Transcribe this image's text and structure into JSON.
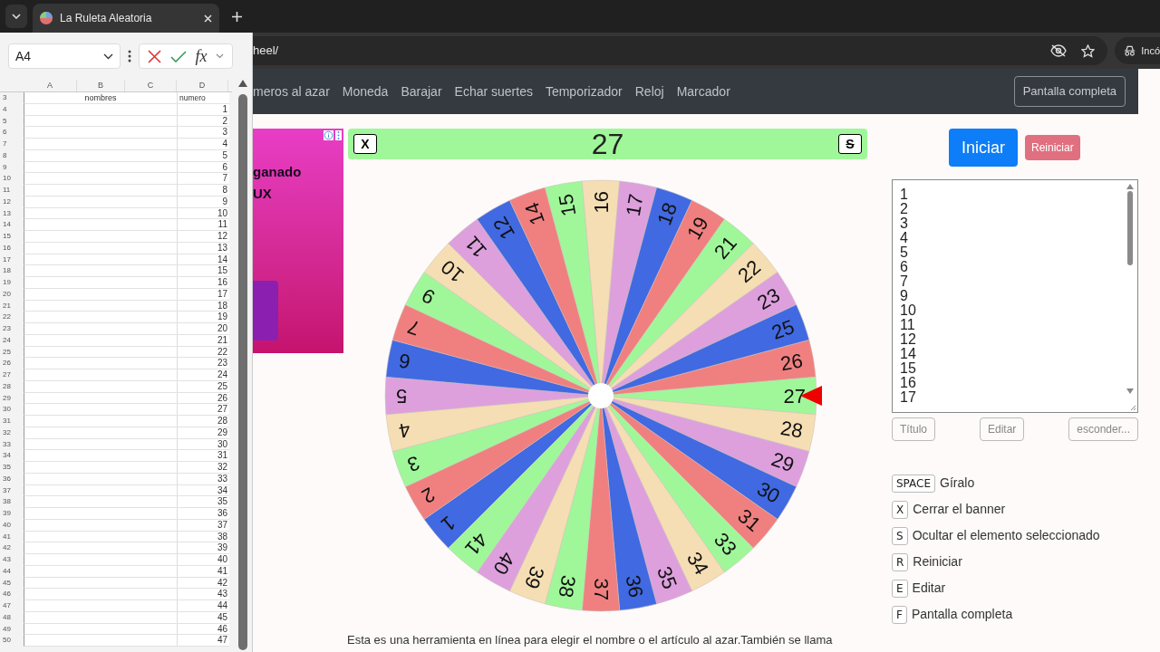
{
  "browser": {
    "tab_title": "La Ruleta Aleatoria",
    "url": "heel/",
    "profile": "Incó"
  },
  "spreadsheet": {
    "name_box": "A4",
    "function_button": "fx",
    "columns": [
      "A",
      "B",
      "C",
      "D"
    ],
    "rows": [
      {
        "row": "3",
        "kind": "header",
        "b": "nombres",
        "d": "numero"
      },
      {
        "row": "4",
        "kind": "value",
        "d": "1"
      },
      {
        "row": "5",
        "kind": "value",
        "d": "2"
      },
      {
        "row": "6",
        "kind": "value",
        "d": "3"
      },
      {
        "row": "7",
        "kind": "value",
        "d": "4"
      },
      {
        "row": "8",
        "kind": "value",
        "d": "5"
      },
      {
        "row": "9",
        "kind": "value",
        "d": "6"
      },
      {
        "row": "10",
        "kind": "value",
        "d": "7"
      },
      {
        "row": "11",
        "kind": "value",
        "d": "8"
      },
      {
        "row": "12",
        "kind": "value",
        "d": "9"
      },
      {
        "row": "13",
        "kind": "value",
        "d": "10"
      },
      {
        "row": "14",
        "kind": "value",
        "d": "11"
      },
      {
        "row": "15",
        "kind": "value",
        "d": "12"
      },
      {
        "row": "16",
        "kind": "value",
        "d": "13"
      },
      {
        "row": "17",
        "kind": "value",
        "d": "14"
      },
      {
        "row": "18",
        "kind": "value",
        "d": "15"
      },
      {
        "row": "19",
        "kind": "value",
        "d": "16"
      },
      {
        "row": "20",
        "kind": "value",
        "d": "17"
      },
      {
        "row": "21",
        "kind": "value",
        "d": "18"
      },
      {
        "row": "22",
        "kind": "value",
        "d": "19"
      },
      {
        "row": "23",
        "kind": "value",
        "d": "20"
      },
      {
        "row": "24",
        "kind": "value",
        "d": "21"
      },
      {
        "row": "25",
        "kind": "value",
        "d": "22"
      },
      {
        "row": "26",
        "kind": "value",
        "d": "23"
      },
      {
        "row": "27",
        "kind": "value",
        "d": "24"
      },
      {
        "row": "28",
        "kind": "value",
        "d": "25"
      },
      {
        "row": "29",
        "kind": "value",
        "d": "26"
      },
      {
        "row": "30",
        "kind": "value",
        "d": "27"
      },
      {
        "row": "31",
        "kind": "value",
        "d": "28"
      },
      {
        "row": "32",
        "kind": "value",
        "d": "29"
      },
      {
        "row": "33",
        "kind": "value",
        "d": "30"
      },
      {
        "row": "34",
        "kind": "value",
        "d": "31"
      },
      {
        "row": "35",
        "kind": "value",
        "d": "32"
      },
      {
        "row": "36",
        "kind": "value",
        "d": "33"
      },
      {
        "row": "37",
        "kind": "value",
        "d": "34"
      },
      {
        "row": "38",
        "kind": "value",
        "d": "35"
      },
      {
        "row": "39",
        "kind": "value",
        "d": "36"
      },
      {
        "row": "40",
        "kind": "value",
        "d": "37"
      },
      {
        "row": "41",
        "kind": "value",
        "d": "38"
      },
      {
        "row": "42",
        "kind": "value",
        "d": "39"
      },
      {
        "row": "43",
        "kind": "value",
        "d": "40"
      },
      {
        "row": "44",
        "kind": "value",
        "d": "41"
      },
      {
        "row": "45",
        "kind": "value",
        "d": "42"
      },
      {
        "row": "46",
        "kind": "value",
        "d": "43"
      },
      {
        "row": "47",
        "kind": "value",
        "d": "44"
      },
      {
        "row": "48",
        "kind": "value",
        "d": "45"
      },
      {
        "row": "49",
        "kind": "value",
        "d": "46"
      },
      {
        "row": "50",
        "kind": "value",
        "d": "47"
      }
    ]
  },
  "nav": {
    "links": [
      "meros al azar",
      "Moneda",
      "Barajar",
      "Echar suertes",
      "Temporizador",
      "Reloj",
      "Marcador"
    ],
    "fullscreen_button": "Pantalla completa"
  },
  "ad": {
    "texts": [
      "ganado",
      "UX"
    ]
  },
  "result": {
    "close_key": "X",
    "value": "27",
    "hide_key": "S"
  },
  "wheel": {
    "segments": [
      {
        "label": "1"
      },
      {
        "label": "2"
      },
      {
        "label": "3"
      },
      {
        "label": "4"
      },
      {
        "label": "5"
      },
      {
        "label": "6"
      },
      {
        "label": "7"
      },
      {
        "label": "9"
      },
      {
        "label": "10"
      },
      {
        "label": "11"
      },
      {
        "label": "12"
      },
      {
        "label": "14"
      },
      {
        "label": "15"
      },
      {
        "label": "16"
      },
      {
        "label": "17"
      },
      {
        "label": "18"
      },
      {
        "label": "19"
      },
      {
        "label": "21"
      },
      {
        "label": "22"
      },
      {
        "label": "23"
      },
      {
        "label": "25"
      },
      {
        "label": "26"
      },
      {
        "label": "27"
      },
      {
        "label": "28"
      },
      {
        "label": "29"
      },
      {
        "label": "30"
      },
      {
        "label": "31"
      },
      {
        "label": "33"
      },
      {
        "label": "34"
      },
      {
        "label": "35"
      },
      {
        "label": "36"
      },
      {
        "label": "37"
      },
      {
        "label": "38"
      },
      {
        "label": "39"
      },
      {
        "label": "40"
      },
      {
        "label": "41"
      }
    ]
  },
  "controls": {
    "start": "Iniciar",
    "reset": "Reiniciar"
  },
  "list": {
    "items": [
      "1",
      "2",
      "3",
      "4",
      "5",
      "6",
      "7",
      "9",
      "10",
      "11",
      "12",
      "14",
      "15",
      "16",
      "17"
    ],
    "buttons": [
      "Título",
      "Editar",
      "esconder..."
    ]
  },
  "shortcuts": [
    {
      "key": "SPACE",
      "label": "Gíralo"
    },
    {
      "key": "X",
      "label": "Cerrar el banner"
    },
    {
      "key": "S",
      "label": "Ocultar el elemento seleccionado"
    },
    {
      "key": "R",
      "label": "Reiniciar"
    },
    {
      "key": "E",
      "label": "Editar"
    },
    {
      "key": "F",
      "label": "Pantalla completa"
    }
  ],
  "description": "Esta es una herramienta en línea para elegir el nombre o el artículo al azar.También se llama"
}
